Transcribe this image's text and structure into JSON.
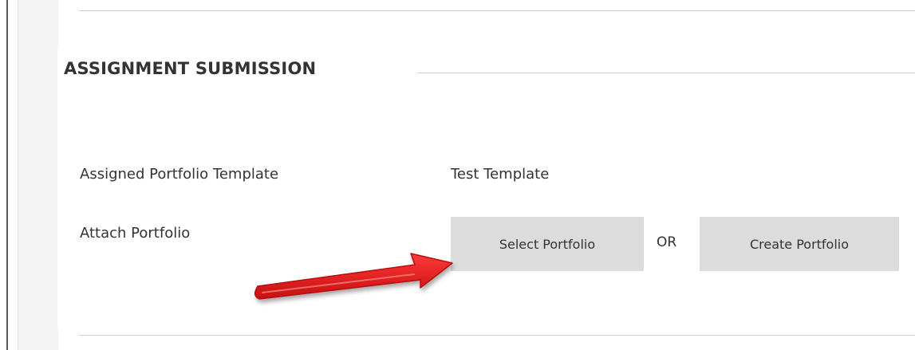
{
  "section": {
    "title": "ASSIGNMENT SUBMISSION"
  },
  "fields": {
    "template_label": "Assigned Portfolio Template",
    "template_value": "Test Template",
    "attach_label": "Attach Portfolio"
  },
  "actions": {
    "select_label": "Select Portfolio",
    "or_label": "OR",
    "create_label": "Create Portfolio"
  },
  "colors": {
    "button_bg": "#dcdcdc",
    "text": "#333333",
    "arrow": "#e01b1b"
  },
  "annotation": {
    "icon": "red-arrow-icon"
  }
}
